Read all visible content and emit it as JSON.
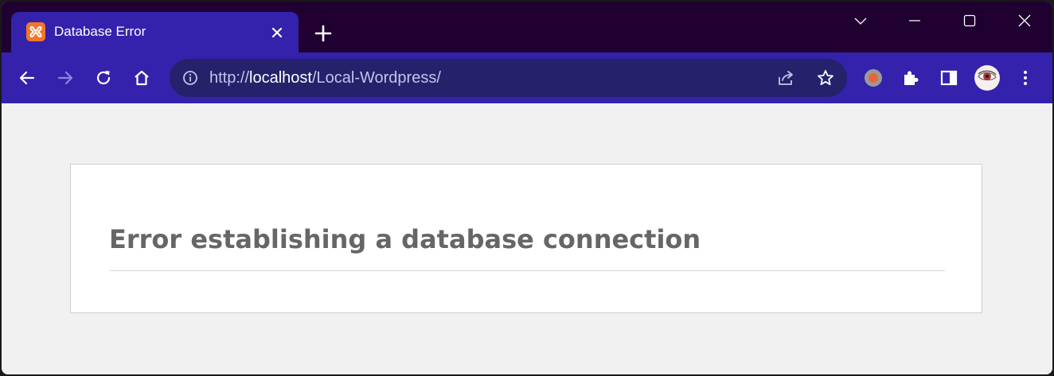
{
  "colors": {
    "tabstrip_bg": "#1f0030",
    "accent": "#3422ad",
    "omnibox_bg": "#25216b",
    "page_bg": "#f1f1f1",
    "heading": "#666666",
    "favicon": "#f2762a"
  },
  "tab": {
    "title": "Database Error",
    "favicon": "xampp-icon",
    "close_icon": "close-icon"
  },
  "tabstrip": {
    "new_tab_icon": "plus-icon",
    "search_tabs_icon": "chevron-down-icon",
    "window_controls": [
      "minimize-icon",
      "maximize-icon",
      "close-icon"
    ]
  },
  "toolbar": {
    "nav_icons": [
      "back-arrow-icon",
      "forward-arrow-icon",
      "reload-icon",
      "home-icon"
    ],
    "url_prefix": "http://",
    "url_host": "localhost",
    "url_path": "/Local-Wordpress/",
    "omnibox_icons": [
      "info-icon",
      "share-icon",
      "star-icon"
    ],
    "extension_icons": [
      "extension-record-icon",
      "puzzle-icon",
      "side-panel-icon",
      "avatar",
      "kebab-menu-icon"
    ]
  },
  "page": {
    "heading": "Error establishing a database connection"
  }
}
